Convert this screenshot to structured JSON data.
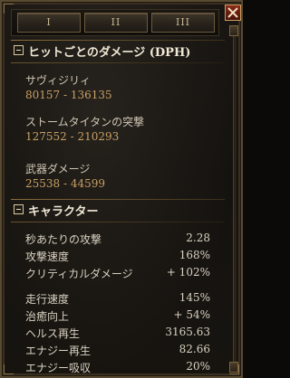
{
  "tabs": [
    {
      "label": "I"
    },
    {
      "label": "II"
    },
    {
      "label": "III"
    }
  ],
  "dph": {
    "title": "ヒットごとのダメージ (DPH)",
    "entries": [
      {
        "label": "サヴィジリィ",
        "value": "80157 - 136135"
      },
      {
        "label": "ストームタイタンの突撃",
        "value": "127552 - 210293"
      },
      {
        "label": "武器ダメージ",
        "value": "25538 - 44599"
      }
    ]
  },
  "character": {
    "title": "キャラクター",
    "stats": [
      {
        "label": "秒あたりの攻撃",
        "value": "2.28"
      },
      {
        "label": "攻撃速度",
        "value": "168%"
      },
      {
        "label": "クリティカルダメージ",
        "value": "+ 102%"
      },
      {
        "label": "走行速度",
        "value": "145%"
      },
      {
        "label": "治癒向上",
        "value": "+ 54%"
      },
      {
        "label": "ヘルス再生",
        "value": "3165.63"
      },
      {
        "label": "エナジー再生",
        "value": "82.66"
      },
      {
        "label": "エナジー吸収",
        "value": "20%"
      }
    ]
  },
  "colors": {
    "value_gold": "#c8a064",
    "text_light": "#d9d1c1",
    "frame_bronze": "#5a4a30"
  },
  "icons": {
    "close": "close-icon",
    "collapse": "minus-box-icon"
  }
}
